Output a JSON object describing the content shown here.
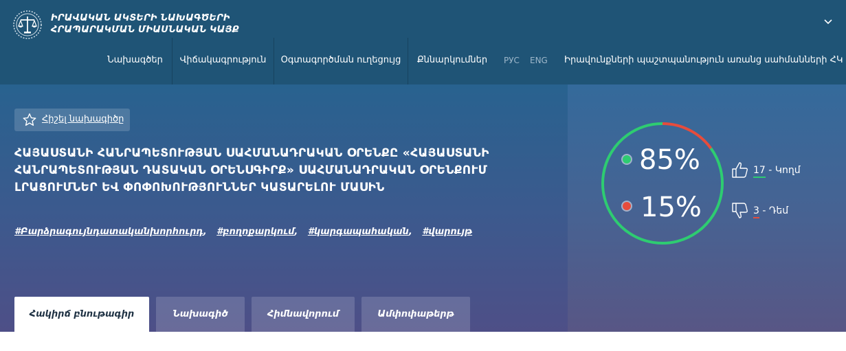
{
  "brand": {
    "line1": "ԻՐԱՎԱԿԱՆ ԱԿՏԵՐԻ ՆԱԽԱԳԾԵՐԻ",
    "line2": "ՀՐԱՊԱՐԱԿՄԱՆ ՄԻԱՍՆԱԿԱՆ ԿԱՅՔ",
    "logo_icon": "scales-of-justice-emblem-icon"
  },
  "nav": {
    "items": [
      "Նախագծեր",
      "Վիճակագրություն",
      "Օգտագործման ուղեցույց",
      "Քննարկումներ"
    ],
    "lang_ru": "РУС",
    "lang_en": "ENG",
    "hrc_link": "Իրավունքների պաշտպանություն առանց սահմանների ՀԿ"
  },
  "project": {
    "remember_label": "Հիշել նախագիծը",
    "title": "ՀԱՅԱՍՏԱՆԻ ՀԱՆՐԱՊԵՏՈՒԹՅԱՆ ՍԱՀՄԱՆԱԴՐԱԿԱՆ ՕՐԵՆՔԸ «ՀԱՅԱՍՏԱՆԻ ՀԱՆՐԱՊԵՏՈՒԹՅԱՆ ԴԱՏԱԿԱՆ ՕՐԵՆՍԳԻՐՔ» ՍԱՀՄԱՆԱԴՐԱԿԱՆ ՕՐԵՆՔՈՒՄ ԼՐԱՑՈՒՄՆԵՐ ԵՎ ՓՈՓՈԽՈՒԹՅՈՒՆՆԵՐ ԿԱՏԱՐԵԼՈՒ ՄԱՍԻՆ",
    "tags": [
      "#Բարձրագույնդատականխորհուրդ",
      "#բողոքարկում",
      "#կարգապահական",
      "#վարույթ"
    ]
  },
  "tabs": [
    "Հակիրճ բնութագիր",
    "Նախագիծ",
    "Հիմնավորում",
    "Ամփոփաթերթ"
  ],
  "votes": {
    "yes_percent": 85,
    "no_percent": 15,
    "yes_text": "85%",
    "no_text": "15%",
    "yes_count": "17",
    "yes_label": " - Կողմ",
    "no_count": "3",
    "no_label": " - Դեմ"
  },
  "colors": {
    "header_bg": "#1f5476",
    "yes": "#2ecc71",
    "no": "#e74c3c"
  }
}
